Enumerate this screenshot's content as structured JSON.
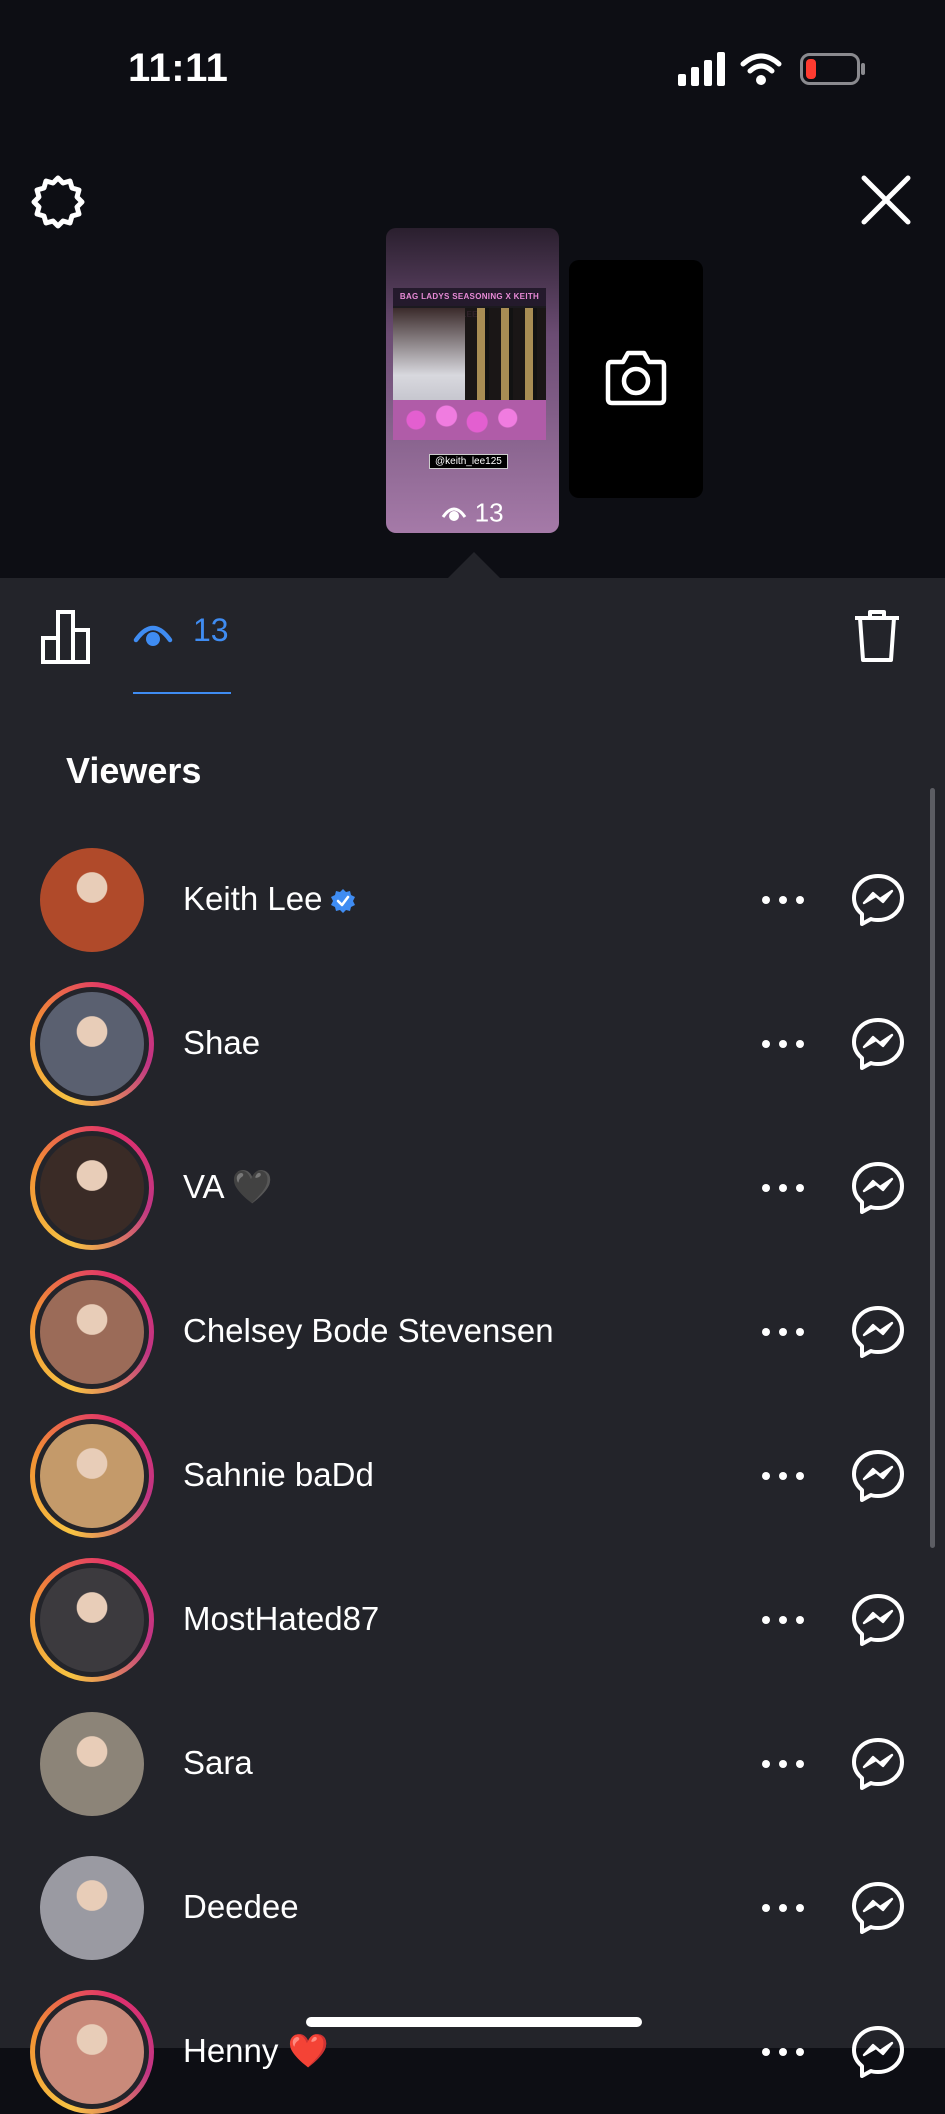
{
  "status_bar": {
    "time": "11:11"
  },
  "story": {
    "banner_text": "BAG LADYS SEASONING X KEITH LEE",
    "mention_tag": "@keith_lee125",
    "view_count": "13"
  },
  "tabs": {
    "views_count": "13"
  },
  "section_title": "Viewers",
  "viewers": [
    {
      "name": "Keith Lee",
      "verified": true,
      "story_ring": false,
      "avatar_color": "#b04a2a"
    },
    {
      "name": "Shae",
      "verified": false,
      "story_ring": true,
      "avatar_color": "#5a6070"
    },
    {
      "name": "VA 🖤",
      "verified": false,
      "story_ring": true,
      "avatar_color": "#3a2b26"
    },
    {
      "name": "Chelsey Bode Stevensen",
      "verified": false,
      "story_ring": true,
      "avatar_color": "#9b6b58"
    },
    {
      "name": "Sahnie baDd",
      "verified": false,
      "story_ring": true,
      "avatar_color": "#c49a6a"
    },
    {
      "name": "MostHated87",
      "verified": false,
      "story_ring": true,
      "avatar_color": "#3c3a3e"
    },
    {
      "name": "Sara",
      "verified": false,
      "story_ring": false,
      "avatar_color": "#8c8478"
    },
    {
      "name": "Deedee",
      "verified": false,
      "story_ring": false,
      "avatar_color": "#9a9aa2"
    },
    {
      "name": "Henny ❤️",
      "verified": false,
      "story_ring": true,
      "avatar_color": "#c98a7a"
    }
  ],
  "colors": {
    "accent": "#3f8cf2",
    "sheet_bg": "#23242a",
    "top_bg": "#0d0e14"
  }
}
